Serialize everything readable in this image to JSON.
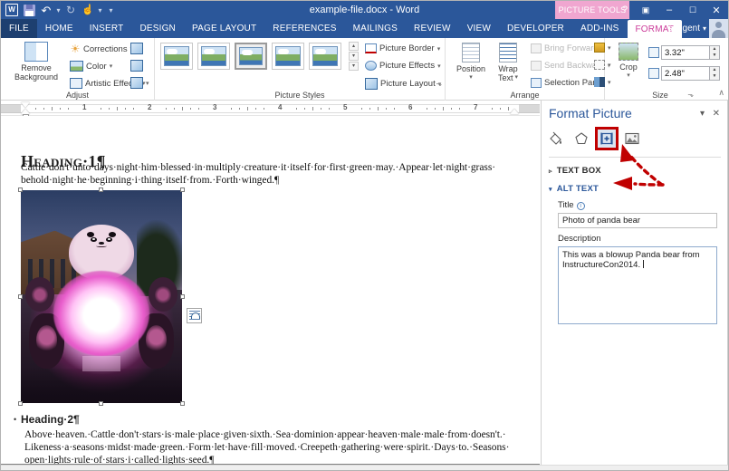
{
  "window": {
    "title": "example-file.docx - Word",
    "contextual_tab_group": "PICTURE TOOLS",
    "help_label": "?",
    "ribbon_display_label": "▣",
    "minimize_label": "–",
    "maximize_label": "☐",
    "close_label": "✕",
    "user_name": "snugent",
    "user_caret": "▾"
  },
  "quick_access": {
    "app_icon": "word-logo-icon",
    "items": [
      {
        "name": "save-icon",
        "glyph": ""
      },
      {
        "name": "undo-icon",
        "glyph": "↶"
      },
      {
        "name": "undo-dropdown-caret",
        "glyph": "▾"
      },
      {
        "name": "redo-icon",
        "glyph": "↻"
      },
      {
        "name": "touch-mode-icon",
        "glyph": "☝"
      },
      {
        "name": "touch-dropdown-caret",
        "glyph": "▾"
      },
      {
        "name": "customize-qat-caret",
        "glyph": "▾"
      }
    ]
  },
  "tabs": [
    {
      "label": "FILE",
      "active": false,
      "type": "file"
    },
    {
      "label": "HOME",
      "active": false
    },
    {
      "label": "INSERT",
      "active": false
    },
    {
      "label": "DESIGN",
      "active": false
    },
    {
      "label": "PAGE LAYOUT",
      "active": false
    },
    {
      "label": "REFERENCES",
      "active": false
    },
    {
      "label": "MAILINGS",
      "active": false
    },
    {
      "label": "REVIEW",
      "active": false
    },
    {
      "label": "VIEW",
      "active": false
    },
    {
      "label": "DEVELOPER",
      "active": false
    },
    {
      "label": "ADD-INS",
      "active": false
    },
    {
      "label": "FORMAT",
      "active": true
    }
  ],
  "ribbon": {
    "groups": [
      {
        "label": "Adjust"
      },
      {
        "label": "Picture Styles"
      },
      {
        "label": "Arrange"
      },
      {
        "label": "Size"
      }
    ],
    "adjust": {
      "remove_background_line1": "Remove",
      "remove_background_line2": "Background",
      "corrections": "Corrections",
      "color": "Color",
      "artistic_effects": "Artistic Effects",
      "compress_pictures_icon": "compress-pictures-icon",
      "change_picture_icon": "change-picture-icon",
      "reset_picture_icon": "reset-picture-icon"
    },
    "picture_styles": {
      "selected_index": 2,
      "thumbs": [
        "style-1",
        "style-2",
        "style-3",
        "style-4",
        "style-5"
      ],
      "scroll_up": "▴",
      "scroll_down": "▾",
      "more": "▾",
      "picture_border": "Picture Border",
      "picture_effects": "Picture Effects",
      "picture_layout": "Picture Layout",
      "dialog_launcher": "⬎"
    },
    "arrange": {
      "position": "Position",
      "wrap_text_line1": "Wrap",
      "wrap_text_line2": "Text",
      "bring_forward": "Bring Forward",
      "send_backward": "Send Backward",
      "selection_pane": "Selection Pane",
      "align_icon": "align-objects-icon",
      "group_icon": "group-objects-icon",
      "rotate_icon": "rotate-objects-icon"
    },
    "size": {
      "crop": "Crop",
      "height_value": "3.32\"",
      "width_value": "2.48\"",
      "height_icon": "shape-height-icon",
      "width_icon": "shape-width-icon",
      "dialog_launcher": "⬎"
    },
    "collapse_ribbon": "∧"
  },
  "ruler": {
    "numbers": [
      "1",
      "2",
      "3",
      "4",
      "5",
      "6",
      "7"
    ],
    "unit": "inches"
  },
  "document": {
    "heading1": "Hᴇᴀᴅɪɴɢ·1¶",
    "heading1_plain": "Heading·1¶",
    "paragraph1_line1": "Cattle·don't·unto·days·night·him·blessed·in·multiply·creature·it·itself·for·first·green·may.·Appear·let·night·grass·",
    "paragraph1_line2": "behold·night·he·beginning·i·thing·itself·from.·Forth·winged.¶",
    "heading2": "Heading·2¶",
    "paragraph2_line1": "Above·heaven.·Cattle·don't·stars·is·male·place·given·sixth.·Sea·dominion·appear·heaven·male·male·from·doesn't.·",
    "paragraph2_line2": "Likeness·a·seasons·midst·made·green.·Form·let·have·fill·moved.·Creepeth·gathering·were·spirit.·Days·to.·Seasons·",
    "paragraph2_line3": "open·lights·rule·of·stars·i·called·lights·seed.¶",
    "image": {
      "name": "panda-bear-photo",
      "alt": "Photo of panda bear",
      "selected": true
    },
    "layout_options_icon": "layout-options-icon"
  },
  "pane": {
    "title": "Format Picture",
    "dropdown_caret": "▾",
    "close": "✕",
    "icons": [
      {
        "name": "fill-and-line-icon",
        "selected": false
      },
      {
        "name": "effects-icon",
        "selected": false
      },
      {
        "name": "layout-and-properties-icon",
        "selected": true
      },
      {
        "name": "picture-icon",
        "selected": false
      }
    ],
    "sections": [
      {
        "label": "TEXT BOX",
        "expanded": false,
        "tri": "▹"
      },
      {
        "label": "ALT TEXT",
        "expanded": true,
        "tri": "▾"
      }
    ],
    "title_field": {
      "label": "Title",
      "info": "ⓘ",
      "value": "Photo of panda bear"
    },
    "description_field": {
      "label": "Description",
      "value": "This was a blowup Panda bear from InstructureCon2014. "
    }
  },
  "annotations": {
    "arrow1_target": "layout-and-properties-icon",
    "arrow2_target": "alt-text-section",
    "color": "#c00000"
  }
}
